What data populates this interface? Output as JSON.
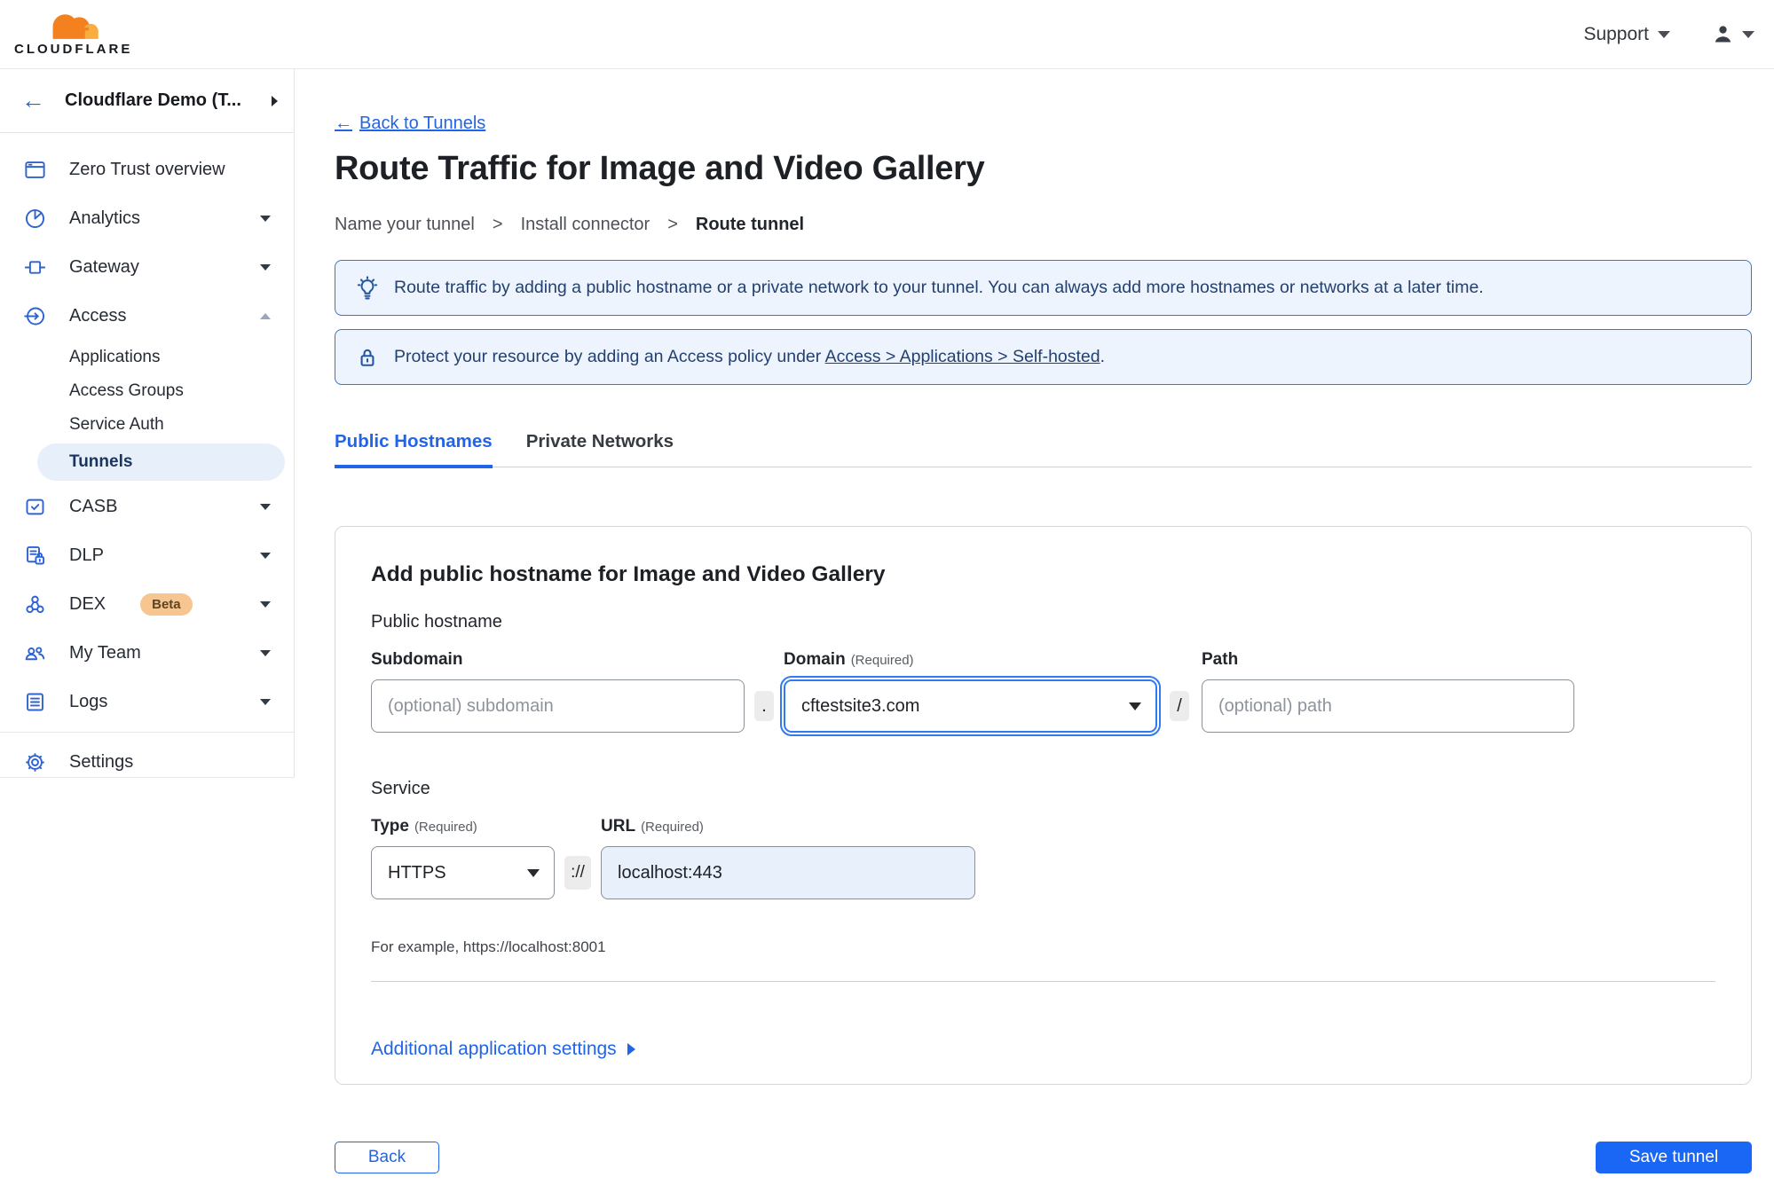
{
  "topbar": {
    "brand": "CLOUDFLARE",
    "support_label": "Support"
  },
  "sidebar": {
    "account_name": "Cloudflare Demo (T...",
    "nav": [
      {
        "label": "Zero Trust overview",
        "icon": "overview-icon",
        "chevron": "none"
      },
      {
        "label": "Analytics",
        "icon": "analytics-icon",
        "chevron": "down"
      },
      {
        "label": "Gateway",
        "icon": "gateway-icon",
        "chevron": "down"
      },
      {
        "label": "Access",
        "icon": "access-icon",
        "chevron": "up"
      },
      {
        "label": "CASB",
        "icon": "casb-icon",
        "chevron": "down"
      },
      {
        "label": "DLP",
        "icon": "dlp-icon",
        "chevron": "down"
      },
      {
        "label": "DEX",
        "icon": "dex-icon",
        "chevron": "down",
        "badge": "Beta"
      },
      {
        "label": "My Team",
        "icon": "team-icon",
        "chevron": "down"
      },
      {
        "label": "Logs",
        "icon": "logs-icon",
        "chevron": "down"
      },
      {
        "label": "Settings",
        "icon": "gear-icon",
        "chevron": "none"
      }
    ],
    "access_sub": [
      {
        "label": "Applications"
      },
      {
        "label": "Access Groups"
      },
      {
        "label": "Service Auth"
      },
      {
        "label": "Tunnels",
        "active": true
      }
    ]
  },
  "main": {
    "back_arrow": "←",
    "back_link": "Back to Tunnels",
    "title": "Route Traffic for Image and Video Gallery",
    "steps": [
      "Name your tunnel",
      "Install connector",
      "Route tunnel"
    ],
    "step_separator": ">",
    "banners": [
      {
        "icon": "lightbulb-icon",
        "text": "Route traffic by adding a public hostname or a private network to your tunnel. You can always add more hostnames or networks at a later time."
      },
      {
        "icon": "lock-icon",
        "prefix": "Protect your resource by adding an Access policy under",
        "link_text": "Access > Applications > Self-hosted",
        "suffix": "."
      }
    ],
    "tabs": [
      {
        "label": "Public Hostnames",
        "active": true
      },
      {
        "label": "Private Networks",
        "active": false
      }
    ],
    "form": {
      "heading": "Add public hostname for Image and Video Gallery",
      "section_public_hostname": "Public hostname",
      "subdomain_label": "Subdomain",
      "subdomain_placeholder": "(optional) subdomain",
      "dot_separator": ".",
      "domain_label": "Domain",
      "required_hint": "(Required)",
      "domain_value": "cftestsite3.com",
      "slash_separator": "/",
      "path_label": "Path",
      "path_placeholder": "(optional) path",
      "section_service": "Service",
      "type_label": "Type",
      "type_value": "HTTPS",
      "scheme_separator": "://",
      "url_label": "URL",
      "url_value": "localhost:443",
      "url_example": "For example, https://localhost:8001",
      "additional_settings_label": "Additional application settings"
    },
    "footer": {
      "back_label": "Back",
      "save_label": "Save tunnel"
    }
  },
  "colors": {
    "accent_blue": "#2264e8",
    "save_button_bg": "#1a66f5",
    "banner_bg": "#edf4fd",
    "banner_border": "#3a75d2",
    "banner_text": "#24406f",
    "active_nav_pill_bg": "#e7effb",
    "beta_badge_bg": "#f7c58f",
    "sidebar_icon_blue": "#2f62d2",
    "brand_orange": "#f48120",
    "brand_orange_light": "#faad3f",
    "url_autofill_bg": "#e8f0fc"
  }
}
